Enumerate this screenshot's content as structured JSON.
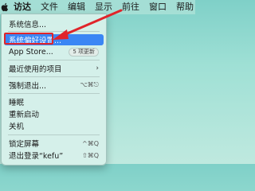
{
  "menubar": {
    "apple_icon": "apple-logo-icon",
    "items": [
      "访达",
      "文件",
      "编辑",
      "显示",
      "前往",
      "窗口",
      "帮助"
    ]
  },
  "menu": {
    "about": "系统信息...",
    "preferences": "系统偏好设置...",
    "appstore": "App Store...",
    "appstore_badge": "5 项更新",
    "recent": "最近使用的项目",
    "recent_chevron": "›",
    "forcequit": "强制退出...",
    "forcequit_shortcut": "⌥⌘⎋",
    "sleep": "睡眠",
    "restart": "重新启动",
    "shutdown": "关机",
    "lock": "锁定屏幕",
    "lock_shortcut": "^⌘Q",
    "logout": "退出登录“kefu”",
    "logout_shortcut": "⇧⌘Q"
  },
  "annotation": {
    "color": "#e0242a"
  },
  "selection_color": "#3b86f4"
}
